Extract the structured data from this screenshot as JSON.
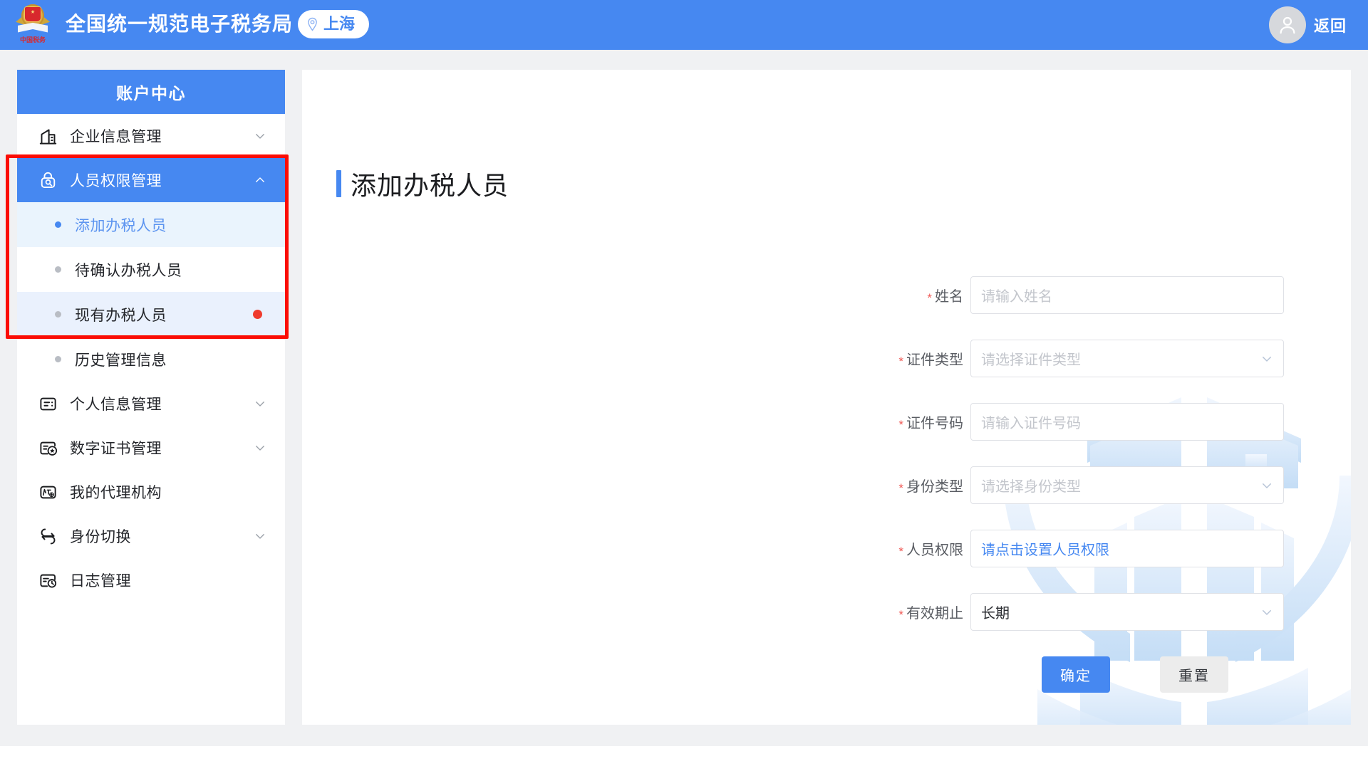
{
  "header": {
    "title": "全国统一规范电子税务局",
    "location": "上海",
    "location_icon": "map-pin-icon",
    "logo_caption": "中国税务",
    "avatar_icon": "user-avatar-icon",
    "back_label": "返回"
  },
  "sidebar": {
    "title": "账户中心",
    "items": [
      {
        "label": "企业信息管理",
        "icon": "building-icon",
        "expandable": true,
        "expanded": false,
        "active": false
      },
      {
        "label": "人员权限管理",
        "icon": "lock-person-icon",
        "expandable": true,
        "expanded": true,
        "active": true
      },
      {
        "label": "个人信息管理",
        "icon": "id-card-icon",
        "expandable": true,
        "expanded": false,
        "active": false
      },
      {
        "label": "数字证书管理",
        "icon": "certificate-star-icon",
        "expandable": true,
        "expanded": false,
        "active": false
      },
      {
        "label": "我的代理机构",
        "icon": "agency-icon",
        "expandable": false,
        "expanded": false,
        "active": false
      },
      {
        "label": "身份切换",
        "icon": "switch-identity-icon",
        "expandable": true,
        "expanded": false,
        "active": false
      },
      {
        "label": "日志管理",
        "icon": "log-clock-icon",
        "expandable": false,
        "expanded": false,
        "active": false
      }
    ],
    "sub_items": [
      {
        "label": "添加办税人员",
        "selected": true,
        "badge": false
      },
      {
        "label": "待确认办税人员",
        "selected": false,
        "badge": false
      },
      {
        "label": "现有办税人员",
        "selected": false,
        "badge": true
      },
      {
        "label": "历史管理信息",
        "selected": false,
        "badge": false
      }
    ]
  },
  "annotation": {
    "highlight_color": "#fb0d05"
  },
  "main": {
    "page_title": "添加办税人员",
    "fields": [
      {
        "label": "姓名",
        "required": true,
        "type": "input",
        "value": "",
        "placeholder": "请输入姓名"
      },
      {
        "label": "证件类型",
        "required": true,
        "type": "select",
        "value": "",
        "placeholder": "请选择证件类型"
      },
      {
        "label": "证件号码",
        "required": true,
        "type": "input",
        "value": "",
        "placeholder": "请输入证件号码"
      },
      {
        "label": "身份类型",
        "required": true,
        "type": "select",
        "value": "",
        "placeholder": "请选择身份类型"
      },
      {
        "label": "人员权限",
        "required": true,
        "type": "link",
        "value": "请点击设置人员权限",
        "placeholder": ""
      },
      {
        "label": "有效期止",
        "required": true,
        "type": "select",
        "value": "长期",
        "placeholder": ""
      }
    ],
    "submit_label": "确定",
    "reset_label": "重置"
  },
  "colors": {
    "brand_blue": "#4688f1",
    "page_bg": "#f0f1f3",
    "panel_bg": "#ffffff",
    "required_red": "#f05a56",
    "badge_red": "#ef3b2d",
    "annotation_red": "#fb0d05",
    "sub_selected_bg": "#eaf4fd",
    "sub_shaded_bg": "#eaf1fd"
  }
}
